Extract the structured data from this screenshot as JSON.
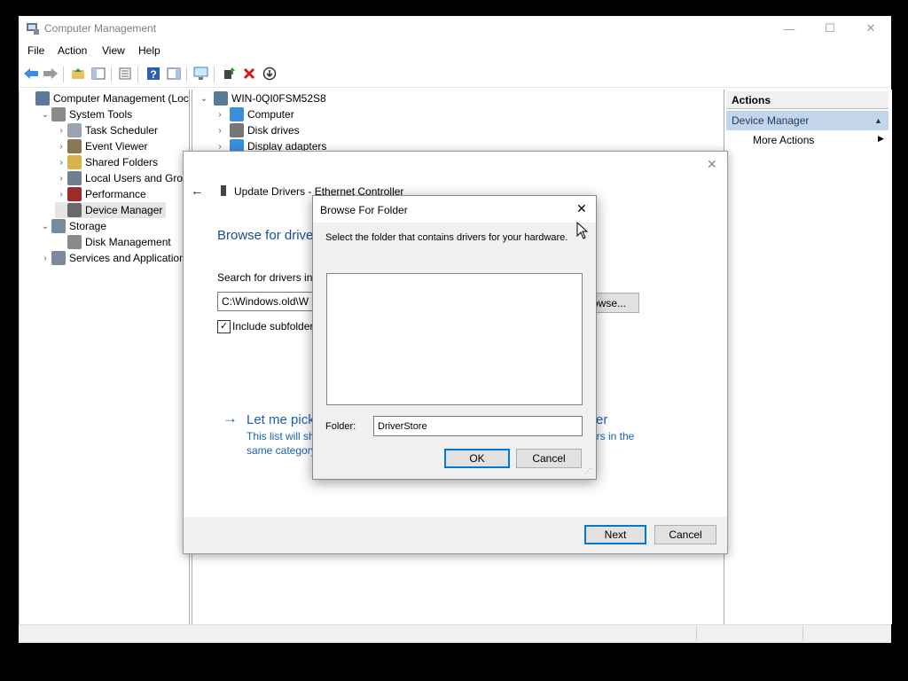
{
  "window": {
    "title": "Computer Management",
    "min": "—",
    "max": "☐",
    "close": "✕"
  },
  "menu": [
    "File",
    "Action",
    "View",
    "Help"
  ],
  "toolbar": {
    "icons": [
      "back-arrow-icon",
      "forward-arrow-icon",
      "up-folder-icon",
      "show-hide-tree-icon",
      "properties-icon",
      "help-icon",
      "show-hide-action-pane-icon",
      "monitor-icon",
      "update-driver-icon",
      "uninstall-icon",
      "disable-device-icon"
    ]
  },
  "tree": {
    "items": [
      {
        "label": "Computer Management (Local",
        "level": 0,
        "chev": "",
        "icon": "computer-mgmt-icon",
        "color": "#5b7a9b"
      },
      {
        "label": "System Tools",
        "level": 1,
        "chev": "⌄",
        "icon": "tools-icon",
        "color": "#8a8a8a"
      },
      {
        "label": "Task Scheduler",
        "level": 2,
        "chev": "›",
        "icon": "clock-icon",
        "color": "#9aa5b1"
      },
      {
        "label": "Event Viewer",
        "level": 2,
        "chev": "›",
        "icon": "event-viewer-icon",
        "color": "#8b7755"
      },
      {
        "label": "Shared Folders",
        "level": 2,
        "chev": "›",
        "icon": "shared-folder-icon",
        "color": "#d8b347"
      },
      {
        "label": "Local Users and Groups",
        "level": 2,
        "chev": "›",
        "icon": "users-icon",
        "color": "#6f7f91"
      },
      {
        "label": "Performance",
        "level": 2,
        "chev": "›",
        "icon": "performance-icon",
        "color": "#a02a2a"
      },
      {
        "label": "Device Manager",
        "level": 2,
        "chev": "",
        "icon": "device-manager-icon",
        "color": "#6a6a6a",
        "selected": true
      },
      {
        "label": "Storage",
        "level": 1,
        "chev": "⌄",
        "icon": "storage-icon",
        "color": "#7a8a9a"
      },
      {
        "label": "Disk Management",
        "level": 2,
        "chev": "",
        "icon": "disk-icon",
        "color": "#8a8a8a"
      },
      {
        "label": "Services and Applications",
        "level": 1,
        "chev": "›",
        "icon": "services-icon",
        "color": "#7a8a9a"
      }
    ]
  },
  "devices": {
    "root": "WIN-0QI0FSM52S8",
    "items": [
      {
        "label": "Computer",
        "icon": "computer-icon",
        "color": "#3a8fd9"
      },
      {
        "label": "Disk drives",
        "icon": "disk-drive-icon",
        "color": "#777"
      },
      {
        "label": "Display adapters",
        "icon": "display-adapter-icon",
        "color": "#3a8fd9"
      }
    ]
  },
  "actions": {
    "header": "Actions",
    "section": "Device Manager",
    "more": "More Actions"
  },
  "update_dialog": {
    "title": "Update Drivers - Ethernet Controller",
    "heading": "Browse for drive",
    "search_label": "Search for drivers in t",
    "path_value": "C:\\Windows.old\\W",
    "browse_label": "owse...",
    "include_sub": "Include subfolder",
    "let_me": "Let me pick",
    "let_me_tail": "er",
    "list_text_1": "This list will sh",
    "list_text_1_tail": "ers in the",
    "list_text_2": "same category",
    "next": "Next",
    "cancel": "Cancel"
  },
  "browse_dialog": {
    "title": "Browse For Folder",
    "instruction": "Select the folder that contains drivers for your hardware.",
    "folder_label": "Folder:",
    "folder_value": "DriverStore",
    "ok": "OK",
    "cancel": "Cancel"
  }
}
